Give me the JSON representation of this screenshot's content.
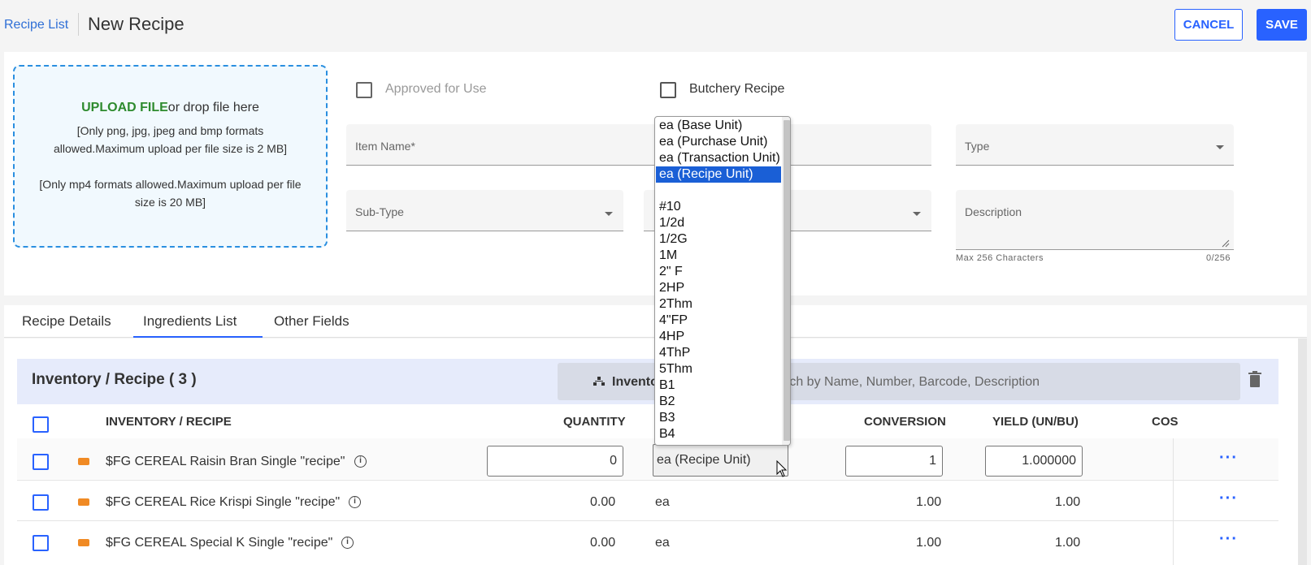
{
  "header": {
    "breadcrumb": "Recipe List",
    "title": "New Recipe",
    "cancel_label": "CANCEL",
    "save_label": "SAVE"
  },
  "upload": {
    "link": "UPLOAD FILE",
    "text": "or drop file here",
    "note_images": "[Only png, jpg, jpeg and bmp formats allowed.Maximum upload per file size is 2 MB]",
    "note_video": "[Only mp4 formats allowed.Maximum upload per file size is 20 MB]"
  },
  "form": {
    "approved_label": "Approved for Use",
    "butchery_label": "Butchery Recipe",
    "item_name_label": "Item Name*",
    "type_label": "Type",
    "subtype_label": "Sub-Type",
    "description_label": "Description",
    "description_helper": "Max 256 Characters",
    "description_count": "0/256"
  },
  "tabs": [
    "Recipe Details",
    "Ingredients List",
    "Other Fields"
  ],
  "inventory": {
    "title": "Inventory / Recipe ( 3 )",
    "button_label": "Invento",
    "search_placeholder": "rch by Name, Number, Barcode, Description"
  },
  "columns": {
    "item": "INVENTORY / RECIPE",
    "quantity": "QUANTITY",
    "conversion": "CONVERSION",
    "yield": "YIELD (UN/BU)",
    "cost": "COS"
  },
  "rows": [
    {
      "name": "$FG CEREAL Raisin Bran Single \"recipe\"",
      "quantity": "0",
      "unit": "ea (Recipe Unit)",
      "conversion": "1",
      "yield": "1.000000"
    },
    {
      "name": "$FG CEREAL Rice Krispi Single \"recipe\"",
      "quantity": "0.00",
      "unit": "ea",
      "conversion": "1.00",
      "yield": "1.00"
    },
    {
      "name": "$FG CEREAL Special K Single \"recipe\"",
      "quantity": "0.00",
      "unit": "ea",
      "conversion": "1.00",
      "yield": "1.00"
    }
  ],
  "unit_dropdown": {
    "options": [
      "ea (Base Unit)",
      "ea (Purchase Unit)",
      "ea (Transaction Unit)",
      "ea (Recipe Unit)",
      "",
      "#10",
      "1/2d",
      "1/2G",
      "1M",
      "2\" F",
      "2HP",
      "2Thm",
      "4\"FP",
      "4HP",
      "4ThP",
      "5Thm",
      "B1",
      "B2",
      "B3",
      "B4"
    ],
    "selected": "ea (Recipe Unit)"
  },
  "colors": {
    "accent": "#2962ff",
    "upload_border": "#2a8fe0",
    "upload_link": "#2e8b2e",
    "item_icon": "#f08a24",
    "selected_option": "#1a5fd6"
  }
}
